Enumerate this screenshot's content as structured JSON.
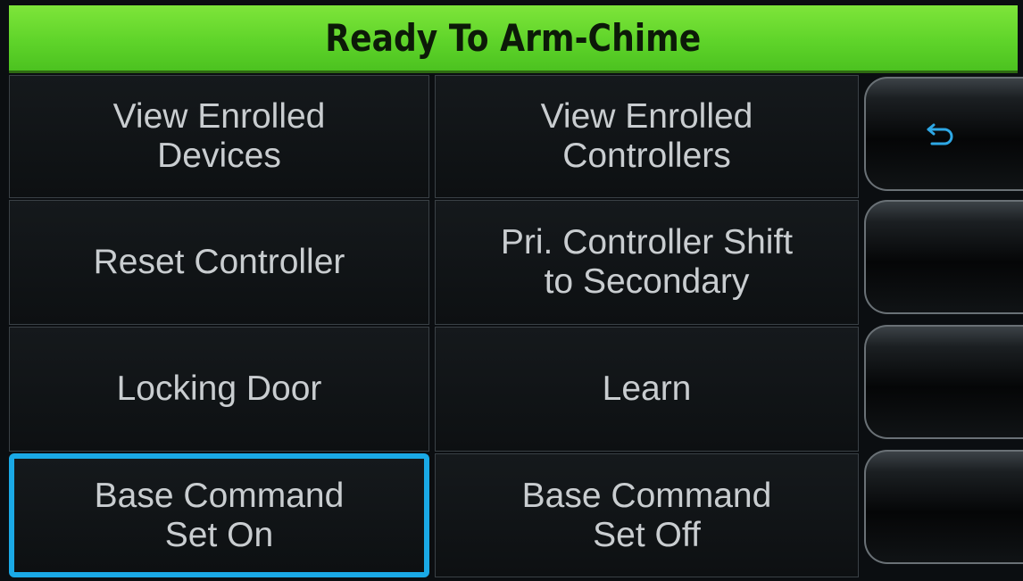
{
  "title": "Ready To Arm-Chime",
  "menu": {
    "items": [
      {
        "label": "View Enrolled\nDevices",
        "selected": false
      },
      {
        "label": "View Enrolled\nControllers",
        "selected": false
      },
      {
        "label": "Reset Controller",
        "selected": false
      },
      {
        "label": "Pri. Controller Shift\nto Secondary",
        "selected": false
      },
      {
        "label": "Locking Door",
        "selected": false
      },
      {
        "label": "Learn",
        "selected": false
      },
      {
        "label": "Base Command\nSet On",
        "selected": true
      },
      {
        "label": "Base Command\nSet Off",
        "selected": false
      }
    ]
  },
  "side_buttons": [
    {
      "icon": "back-arrow-icon"
    },
    {
      "icon": ""
    },
    {
      "icon": ""
    },
    {
      "icon": ""
    }
  ],
  "colors": {
    "title_bar": "#5fd42a",
    "selection_outline": "#1aa9e6",
    "button_text": "#c9cdd0"
  }
}
